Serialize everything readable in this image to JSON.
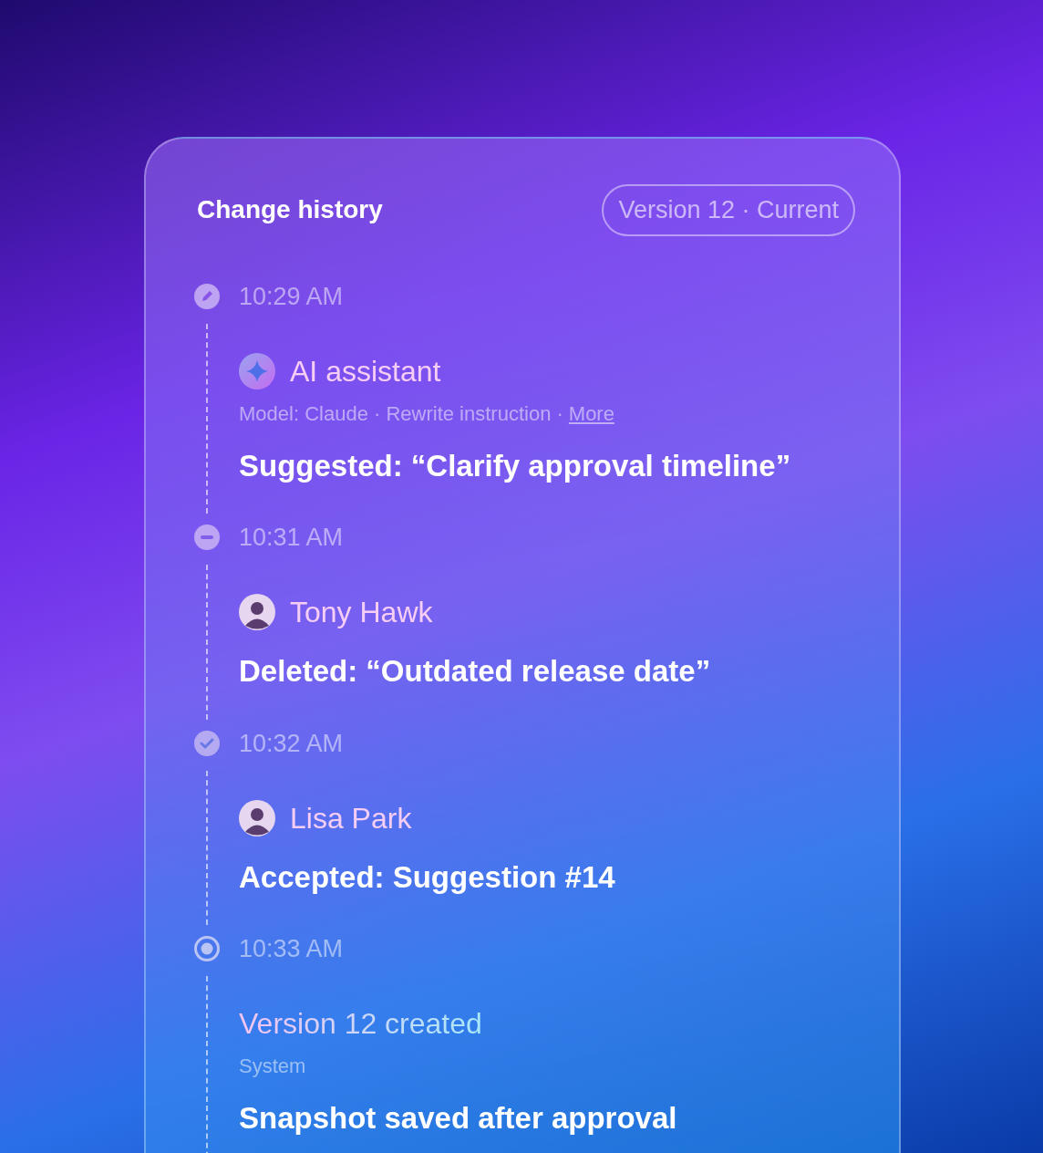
{
  "panel": {
    "title": "Change history",
    "version_badge": "Version 12 · Current"
  },
  "entries": [
    {
      "kind": "edit",
      "time": "10:29 AM",
      "actor": {
        "kind": "ai",
        "name": "AI assistant"
      },
      "meta": "Model: Claude · Rewrite instruction ·",
      "meta_link": "More",
      "action": "Suggested: “Clarify approval timeline”"
    },
    {
      "kind": "delete",
      "time": "10:31 AM",
      "actor": {
        "kind": "person",
        "name": "Tony Hawk"
      },
      "action": "Deleted: “Outdated release date”"
    },
    {
      "kind": "accept",
      "time": "10:32 AM",
      "actor": {
        "kind": "person",
        "name": "Lisa Park"
      },
      "action": "Accepted: Suggestion #14"
    },
    {
      "kind": "version",
      "time": "10:33 AM",
      "actor": {
        "kind": "system",
        "name": "Version 12 created"
      },
      "meta": "System",
      "action": "Snapshot saved after approval"
    }
  ]
}
